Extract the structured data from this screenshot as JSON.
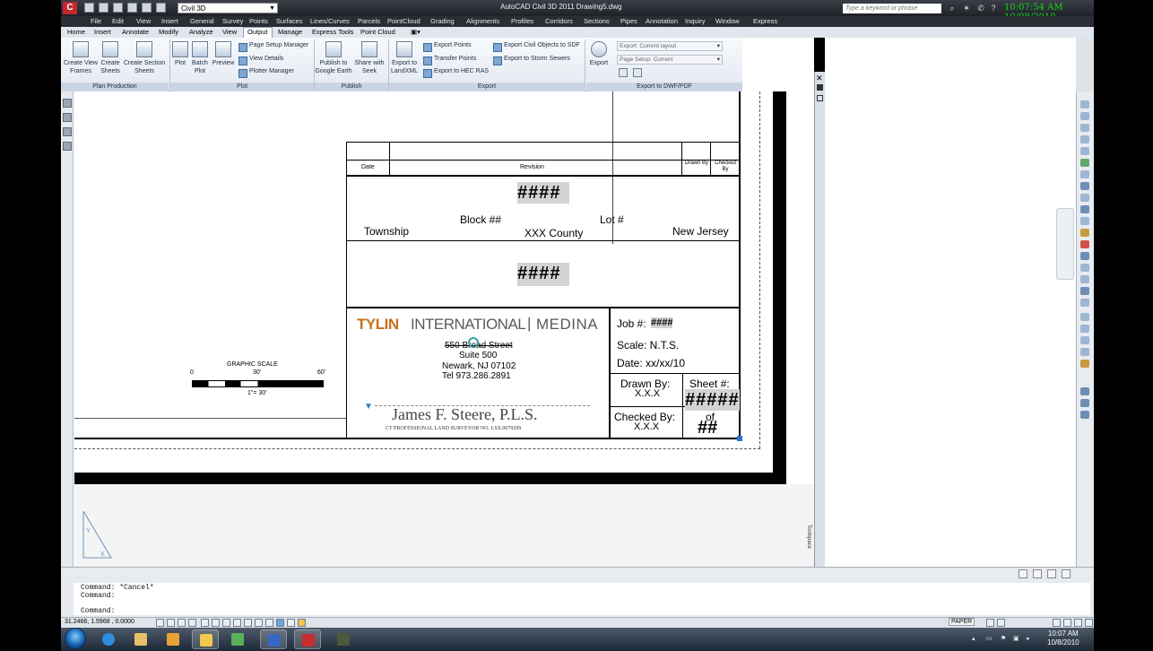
{
  "titlebar": {
    "app_logo": "C",
    "workspace": "Civil 3D",
    "window_title": "AutoCAD Civil 3D 2011    Drawing5.dwg",
    "search_placeholder": "Type a keyword or phrase",
    "clock": "10:07:54 AM 10/08/2010"
  },
  "menubar": [
    "File",
    "Edit",
    "View",
    "Insert",
    "General",
    "Survey",
    "Points",
    "Surfaces",
    "Lines/Curves",
    "Parcels",
    "PointCloud",
    "Grading",
    "Alignments",
    "Profiles",
    "Corridors",
    "Sections",
    "Pipes",
    "Annotation",
    "Inquiry",
    "Window",
    "Express"
  ],
  "ribbon_tabs": [
    "Home",
    "Insert",
    "Annotate",
    "Modify",
    "Analyze",
    "View",
    "Output",
    "Manage",
    "Express Tools",
    "Point Cloud"
  ],
  "ribbon_active_tab": "Output",
  "ribbon": {
    "plan_production": {
      "title": "Plan Production",
      "buttons": [
        "Create View Frames",
        "Create Sheets",
        "Create Section Sheets"
      ]
    },
    "plot": {
      "title": "Plot",
      "big": [
        "Plot",
        "Batch Plot",
        "Preview"
      ],
      "small": [
        "Page Setup Manager",
        "View Details",
        "Plotter Manager"
      ]
    },
    "publish": {
      "title": "Publish",
      "buttons": [
        "Publish to Google Earth",
        "Share with Seek"
      ]
    },
    "export": {
      "title": "Export",
      "big": "Export to LandXML",
      "small": [
        "Export Points",
        "Transfer Points",
        "Export to HEC RAS",
        "Export Civil Objects to SDF",
        "Export to Storm Sewers"
      ]
    },
    "dwf": {
      "title": "Export to DWF/PDF",
      "big": "Export",
      "combo1": "Export: Current layout",
      "combo2": "Page Setup: Current"
    }
  },
  "title_block": {
    "date_label": "Date",
    "revision_label": "Revision",
    "drawn_by_label": "Drawn By",
    "checked_by_label": "Checked By",
    "hash1": "####",
    "block": "Block ##",
    "lot": "Lot #",
    "township": "Township",
    "county": "XXX County",
    "state": "New Jersey",
    "hash2": "####",
    "company_a": "TYLIN",
    "company_b": "INTERNATIONAL",
    "company_sep": "|",
    "company_c": "MEDINA",
    "address1": "550 Broad Street",
    "address2": "Suite 500",
    "address3": "Newark, NJ 07102",
    "phone": "Tel   973.286.2891",
    "signature": "James F. Steere, P.L.S.",
    "license": "CT PROFESSIONAL LAND SURVEYOR NO. LSX.0070299",
    "job_label": "Job #:",
    "job_value": "####",
    "scale": "Scale: N.T.S.",
    "date": "Date:  xx/xx/10",
    "drawn_by": "Drawn By:",
    "drawn_by_val": "X.X.X",
    "sheet": "Sheet #:",
    "sheet_val": "#####",
    "checked_by": "Checked By:",
    "checked_by_val": "X.X.X",
    "of": "of",
    "of_val": "##"
  },
  "graphic_scale": {
    "label": "GRAPHIC SCALE",
    "t0": "0",
    "t1": "30'",
    "t2": "60'",
    "ratio": "1\"= 30'"
  },
  "tool_palette_label": "Toolspace",
  "command_lines": [
    "Command: *Cancel*",
    "Command:",
    "",
    "Command:"
  ],
  "status": {
    "coords": "31.2466, 1.5968 , 0.0000",
    "paper": "PAPER"
  },
  "taskbar": {
    "time": "10:07 AM",
    "date": "10/8/2010"
  }
}
